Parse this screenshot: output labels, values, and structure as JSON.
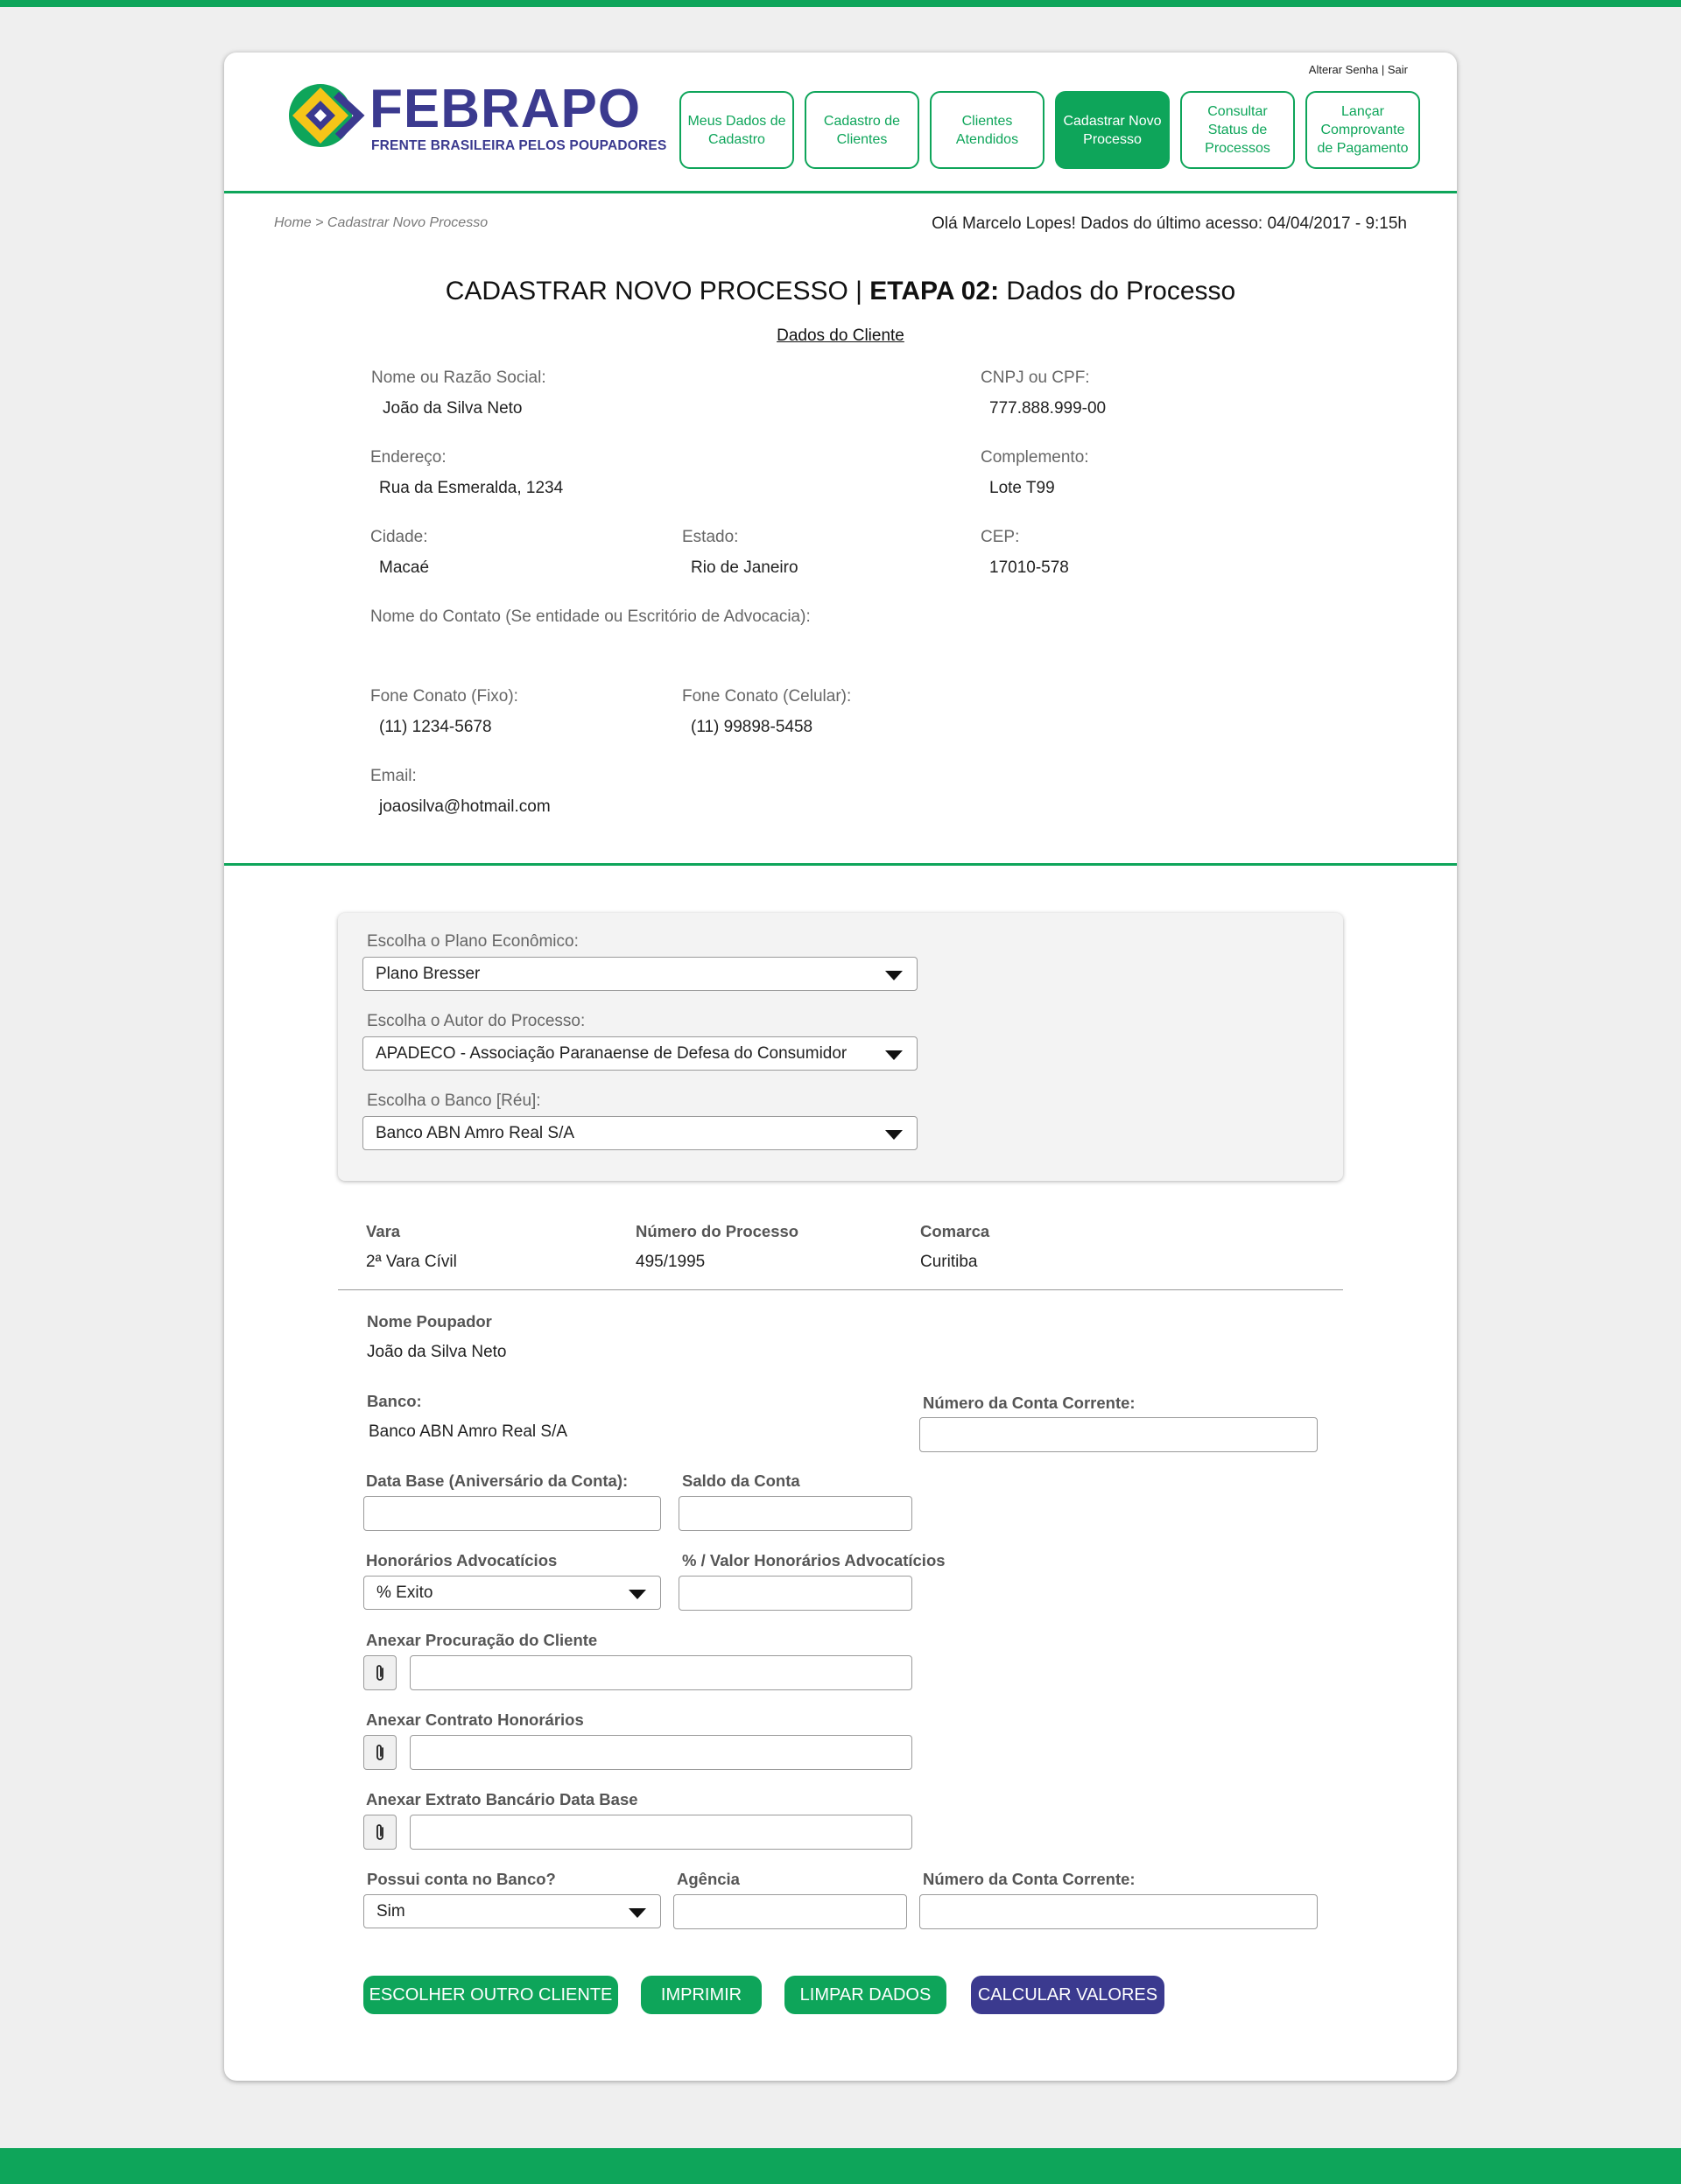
{
  "header": {
    "account_links": "Alterar Senha | Sair",
    "logo_word": "FEBRAPO",
    "logo_tagline": "FRENTE BRASILEIRA PELOS POUPADORES",
    "nav": [
      {
        "label": "Meus Dados de Cadastro"
      },
      {
        "label": "Cadastro de Clientes"
      },
      {
        "label": "Clientes Atendidos"
      },
      {
        "label": "Cadastrar Novo Processo"
      },
      {
        "label": "Consultar Status de Processos"
      },
      {
        "label": "Lançar Comprovante de Pagamento"
      }
    ],
    "active_nav_index": 3
  },
  "breadcrumb": "Home > Cadastrar Novo Processo",
  "greeting": "Olá Marcelo Lopes! Dados do último acesso: 04/04/2017 - 9:15h",
  "title": {
    "prefix": "CADASTRAR NOVO PROCESSO | ",
    "bold": "ETAPA 02:",
    "suffix": " Dados do Processo"
  },
  "client_section_title": "Dados do Cliente",
  "client": {
    "name_label": "Nome ou Razão Social:",
    "name": "João da Silva Neto",
    "doc_label": "CNPJ ou CPF:",
    "doc": "777.888.999-00",
    "address_label": "Endereço:",
    "address": "Rua da Esmeralda, 1234",
    "complement_label": "Complemento:",
    "complement": "Lote T99",
    "city_label": "Cidade:",
    "city": "Macaé",
    "state_label": "Estado:",
    "state": "Rio de Janeiro",
    "cep_label": "CEP:",
    "cep": "17010-578",
    "contact_label": "Nome do Contato (Se entidade ou Escritório de Advocacia):",
    "phone_fixed_label": "Fone Conato (Fixo):",
    "phone_fixed": "(11) 1234-5678",
    "phone_mobile_label": "Fone Conato (Celular):",
    "phone_mobile": "(11) 99898-5458",
    "email_label": "Email:",
    "email": "joaosilva@hotmail.com"
  },
  "selection": {
    "plano_label": "Escolha o Plano Econômico:",
    "plano_value": "Plano Bresser",
    "autor_label": "Escolha o Autor do  Processo:",
    "autor_value": "APADECO - Associação Paranaense de Defesa do Consumidor",
    "banco_label": "Escolha o Banco [Réu]:",
    "banco_value": "Banco ABN Amro Real S/A"
  },
  "process": {
    "vara_label": "Vara",
    "vara": "2ª Vara Cívil",
    "numero_label": "Número do Processo",
    "numero": "495/1995",
    "comarca_label": "Comarca",
    "comarca": "Curitiba"
  },
  "form": {
    "poupador_label": "Nome Poupador",
    "poupador": "João da Silva Neto",
    "banco_label": "Banco:",
    "banco": "Banco ABN Amro Real S/A",
    "conta_label": "Número da Conta Corrente:",
    "data_base_label": "Data Base (Aniversário da Conta):",
    "saldo_label": "Saldo da Conta",
    "honorarios_label": "Honorários Advocatícios",
    "honorarios_value": "% Exito",
    "valor_honorarios_label": "% / Valor Honorários Advocatícios",
    "anexo_procuracao_label": "Anexar Procuração do Cliente",
    "anexo_contrato_label": "Anexar Contrato Honorários",
    "anexo_extrato_label": "Anexar Extrato Bancário Data Base",
    "possui_conta_label": "Possui conta no Banco?",
    "possui_conta_value": "Sim",
    "agencia_label": "Agência",
    "conta2_label": "Número da Conta Corrente:"
  },
  "actions": {
    "escolher": "ESCOLHER OUTRO CLIENTE",
    "imprimir": "IMPRIMIR",
    "limpar": "LIMPAR DADOS",
    "calcular": "CALCULAR VALORES"
  },
  "colors": {
    "green": "#0ea55a",
    "purple": "#3b3a8f"
  }
}
